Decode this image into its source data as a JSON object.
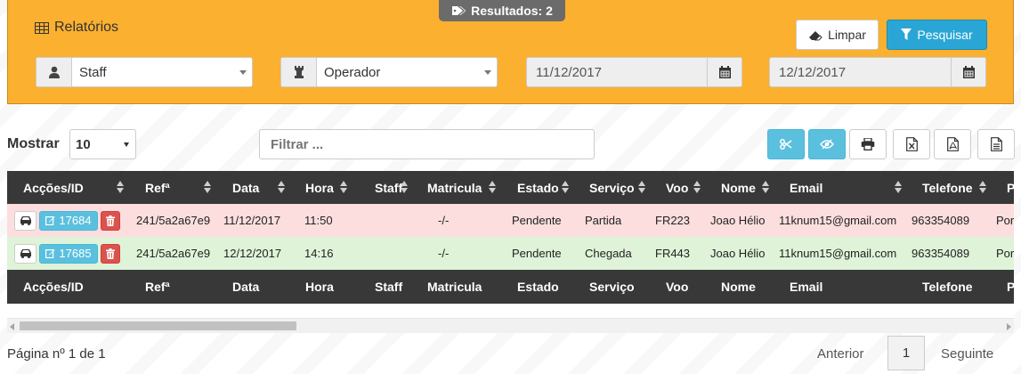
{
  "results_badge": {
    "label": "Resultados: 2",
    "icon": "tags-icon"
  },
  "panel": {
    "title": "Relatórios",
    "clear_label": "Limpar",
    "search_label": "Pesquisar",
    "staff_select": "Staff",
    "operator_select": "Operador",
    "date_from": "11/12/2017",
    "date_to": "12/12/2017"
  },
  "toolbar": {
    "show_label": "Mostrar",
    "page_size": "10",
    "filter_placeholder": "Filtrar ..."
  },
  "table": {
    "columns": [
      "Acções/ID",
      "Refª",
      "Data",
      "Hora",
      "Staff",
      "Matricula",
      "Estado",
      "Serviço",
      "Voo",
      "Nome",
      "Email",
      "Telefone",
      "P"
    ],
    "rows": [
      {
        "id": "17684",
        "ref": "241/5a2a67e9",
        "date": "11/12/2017",
        "time": "11:50",
        "staff": "",
        "plate": "-/-",
        "status": "Pendente",
        "service": "Partida",
        "flight": "FR223",
        "name": "Joao Hélio",
        "email": "11knum15@gmail.com",
        "phone": "963354089",
        "extra": "Port"
      },
      {
        "id": "17685",
        "ref": "241/5a2a67e9",
        "date": "12/12/2017",
        "time": "14:16",
        "staff": "",
        "plate": "-/-",
        "status": "Pendente",
        "service": "Chegada",
        "flight": "FR443",
        "name": "Joao Hélio",
        "email": "11knum15@gmail.com",
        "phone": "963354089",
        "extra": "Port"
      }
    ]
  },
  "pagination": {
    "info": "Página nº 1 de 1",
    "prev": "Anterior",
    "current": "1",
    "next": "Seguinte"
  },
  "colors": {
    "panel_bg": "#fbb02f",
    "primary": "#2aa6d6",
    "info": "#5bc0de",
    "danger": "#d9534f",
    "header_dark": "#383838",
    "row_pending": "#fcdede",
    "row_done": "#dff3d8"
  }
}
